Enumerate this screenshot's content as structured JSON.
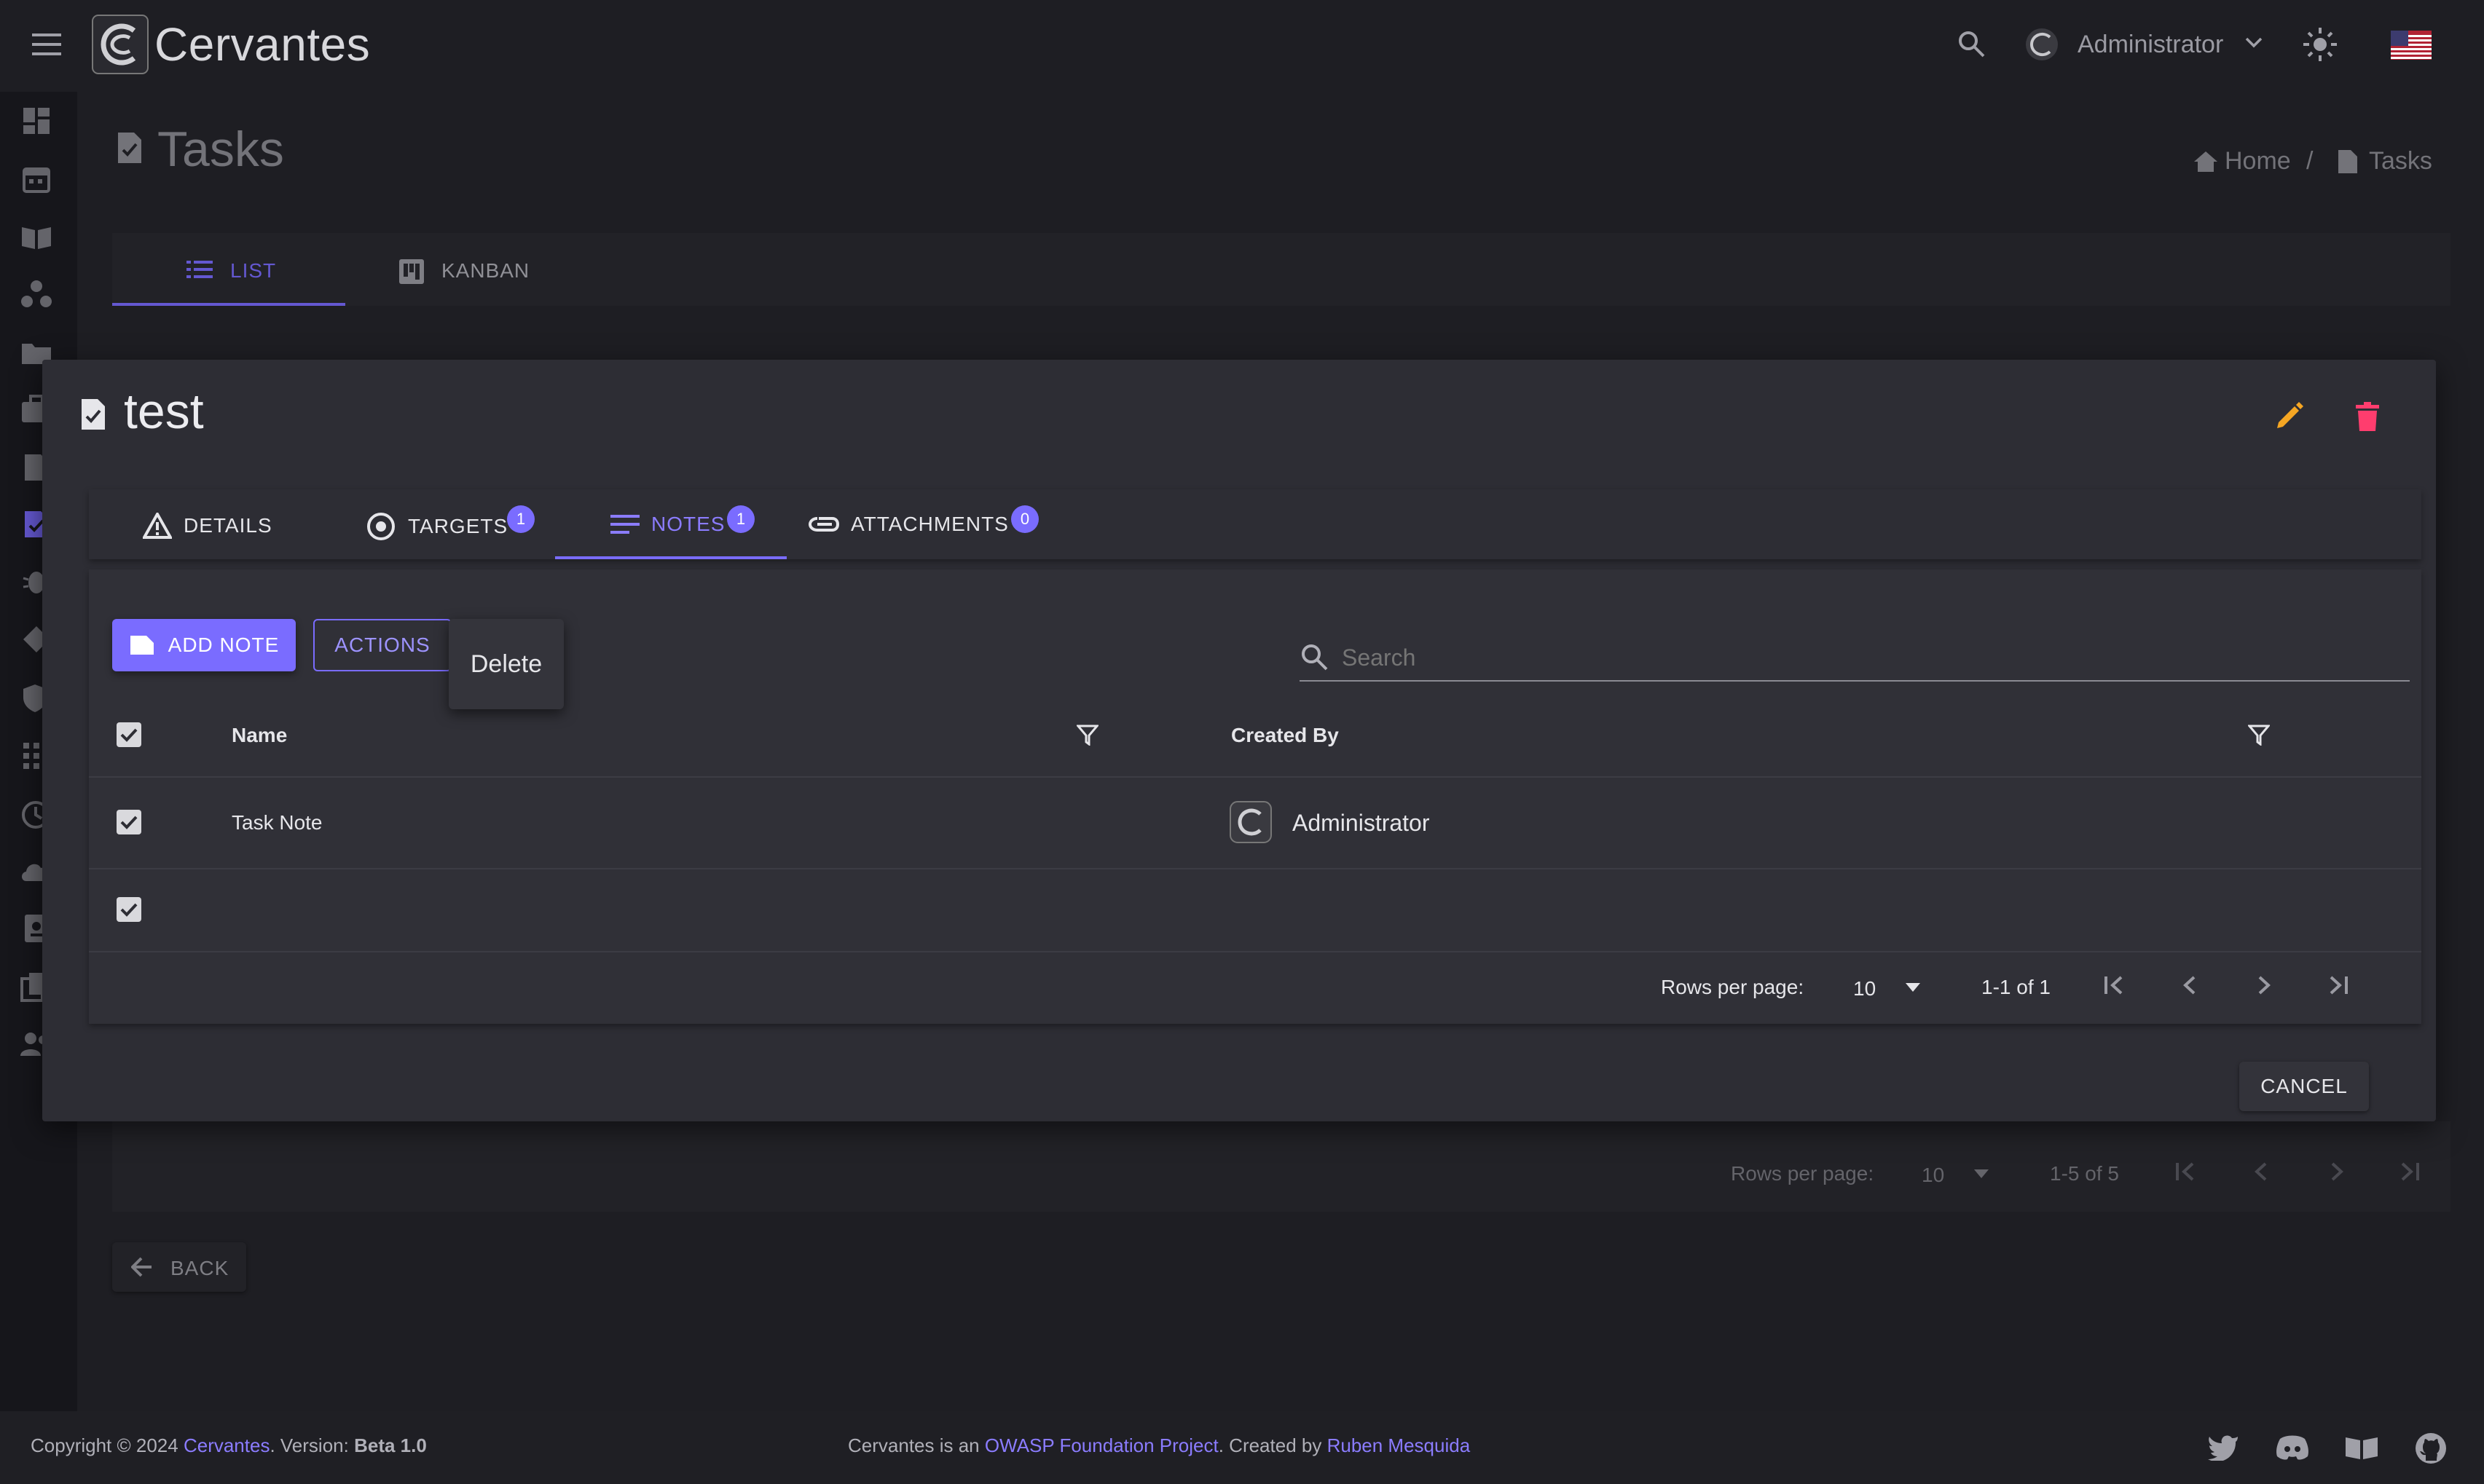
{
  "app": {
    "brand": "Cervantes",
    "user": "Administrator"
  },
  "page": {
    "title": "Tasks",
    "breadcrumb": [
      "Home",
      "Tasks"
    ],
    "tabs": [
      {
        "label": "LIST",
        "active": true
      },
      {
        "label": "KANBAN",
        "active": false
      }
    ],
    "pager": {
      "rows_label": "Rows per page:",
      "rows_value": "10",
      "range": "1-5 of 5"
    },
    "back_label": "BACK"
  },
  "dialog": {
    "title": "test",
    "tabs": [
      {
        "label": "DETAILS",
        "badge": ""
      },
      {
        "label": "TARGETS",
        "badge": "1"
      },
      {
        "label": "NOTES",
        "badge": "1",
        "active": true
      },
      {
        "label": "ATTACHMENTS",
        "badge": "0"
      }
    ],
    "add_note_label": "ADD NOTE",
    "actions_label": "ACTIONS",
    "actions_menu": [
      "Delete"
    ],
    "search_placeholder": "Search",
    "table": {
      "columns": [
        "Name",
        "Created By"
      ],
      "rows": [
        {
          "name": "Task Note",
          "created_by": "Administrator",
          "checked": true
        }
      ]
    },
    "pager": {
      "rows_label": "Rows per page:",
      "rows_value": "10",
      "range": "1-1 of 1"
    },
    "cancel_label": "CANCEL"
  },
  "footer": {
    "copyright_prefix": "Copyright © 2024",
    "brand_link": "Cervantes",
    "version_prefix": ". Version:",
    "version": "Beta 1.0",
    "owasp_prefix": "Cervantes is an",
    "owasp_link": "OWASP Foundation Project",
    "created_prefix": ". Created by",
    "author_link": "Ruben Mesquida"
  },
  "colors": {
    "accent": "#7a6cff",
    "edit": "#f5a623",
    "delete": "#ff3d6e"
  }
}
